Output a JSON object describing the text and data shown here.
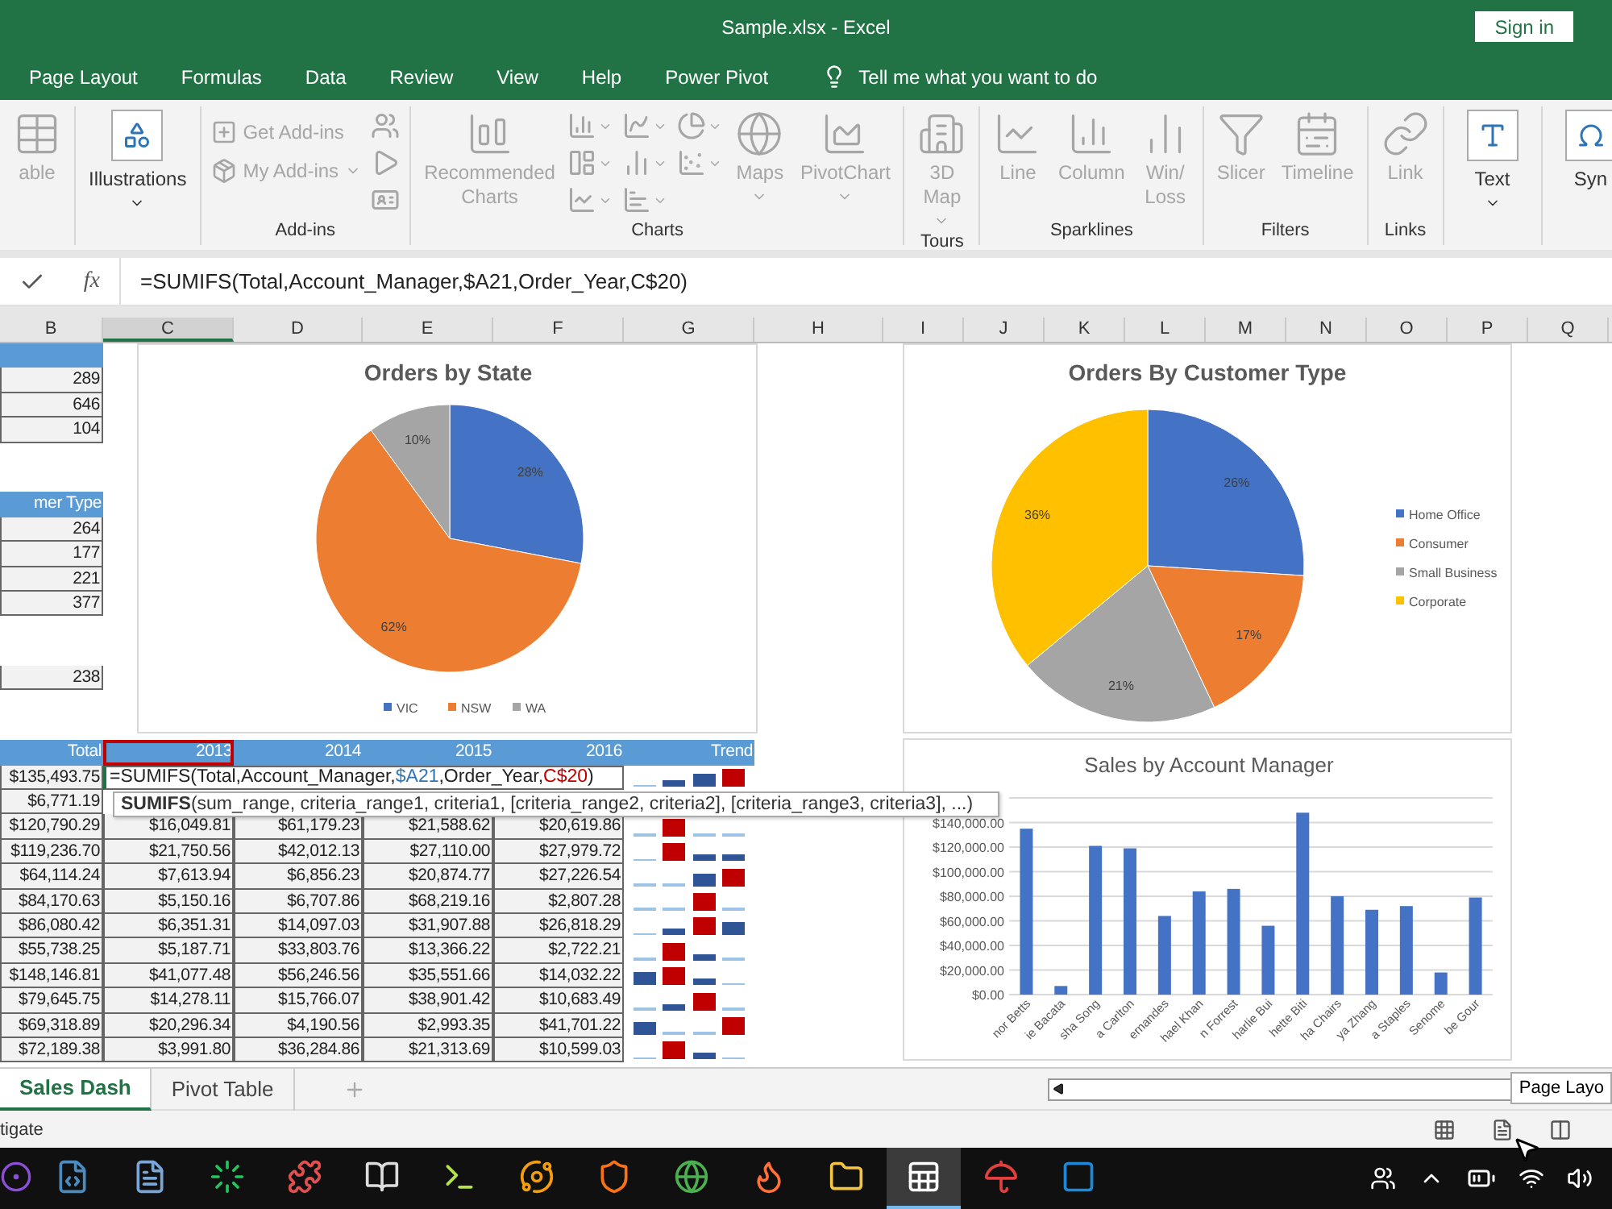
{
  "window": {
    "title": "Sample.xlsx - Excel",
    "sign_in": "Sign in"
  },
  "ribbon_tabs": [
    {
      "label": "Page Layout",
      "selected": false
    },
    {
      "label": "Formulas",
      "selected": false
    },
    {
      "label": "Data",
      "selected": false
    },
    {
      "label": "Review",
      "selected": false
    },
    {
      "label": "View",
      "selected": false
    },
    {
      "label": "Help",
      "selected": false
    },
    {
      "label": "Power Pivot",
      "selected": false
    }
  ],
  "tell_me": "Tell me what you want to do",
  "ribbon_groups": [
    {
      "items": [
        {
          "kind": "large",
          "label": "able",
          "disabled": true,
          "dropdown": false
        }
      ]
    },
    {
      "items": [
        {
          "kind": "collapsed",
          "label": "Illustrations",
          "disabled": false,
          "dropdown": true
        }
      ]
    },
    {
      "label": "Add-ins",
      "items": [
        {
          "kind": "small",
          "label": "Get Add-ins",
          "disabled": true,
          "dropdown": false
        },
        {
          "kind": "small",
          "label": "My Add-ins",
          "disabled": true,
          "dropdown": true
        },
        {
          "kind": "icon",
          "disabled": true,
          "dropdown": false
        },
        {
          "kind": "icon",
          "disabled": true,
          "dropdown": false
        },
        {
          "kind": "icon",
          "disabled": true,
          "dropdown": false
        }
      ]
    },
    {
      "label": "Charts",
      "items": [
        {
          "kind": "large",
          "label": "Recommended\nCharts",
          "disabled": true,
          "dropdown": false
        },
        {
          "kind": "icon",
          "disabled": true,
          "dropdown": true
        },
        {
          "kind": "icon",
          "disabled": true,
          "dropdown": true
        },
        {
          "kind": "icon",
          "disabled": true,
          "dropdown": true
        },
        {
          "kind": "icon",
          "disabled": true,
          "dropdown": true
        },
        {
          "kind": "icon",
          "disabled": true,
          "dropdown": true
        },
        {
          "kind": "icon",
          "disabled": true,
          "dropdown": true
        },
        {
          "kind": "icon",
          "disabled": true,
          "dropdown": true
        },
        {
          "kind": "icon",
          "disabled": true,
          "dropdown": true
        },
        {
          "kind": "large",
          "label": "Maps",
          "disabled": true,
          "dropdown": true
        },
        {
          "kind": "large",
          "label": "PivotChart",
          "disabled": true,
          "dropdown": true
        }
      ]
    },
    {
      "label": "Tours",
      "items": [
        {
          "kind": "large",
          "label": "3D\nMap",
          "disabled": true,
          "dropdown": true
        }
      ]
    },
    {
      "label": "Sparklines",
      "items": [
        {
          "kind": "large",
          "label": "Line",
          "disabled": true,
          "dropdown": false
        },
        {
          "kind": "large",
          "label": "Column",
          "disabled": true,
          "dropdown": false
        },
        {
          "kind": "large",
          "label": "Win/\nLoss",
          "disabled": true,
          "dropdown": false
        }
      ]
    },
    {
      "label": "Filters",
      "items": [
        {
          "kind": "large",
          "label": "Slicer",
          "disabled": true,
          "dropdown": false
        },
        {
          "kind": "large",
          "label": "Timeline",
          "disabled": true,
          "dropdown": false
        }
      ]
    },
    {
      "label": "Links",
      "items": [
        {
          "kind": "large",
          "label": "Link",
          "disabled": true,
          "dropdown": false
        }
      ]
    },
    {
      "items": [
        {
          "kind": "collapsed",
          "label": "Text",
          "disabled": false,
          "dropdown": true
        }
      ]
    },
    {
      "items": [
        {
          "kind": "collapsed",
          "label": "Syn",
          "disabled": false,
          "dropdown": false
        }
      ]
    }
  ],
  "formula_bar": {
    "function_label": "fx",
    "formula": "=SUMIFS(Total,Account_Manager,$A21,Order_Year,C$20)"
  },
  "columns": [
    {
      "label": "B",
      "selected": false
    },
    {
      "label": "C",
      "selected": true
    },
    {
      "label": "D",
      "selected": false
    },
    {
      "label": "E",
      "selected": false
    },
    {
      "label": "F",
      "selected": false
    },
    {
      "label": "G",
      "selected": false
    },
    {
      "label": "H",
      "selected": false
    },
    {
      "label": "I",
      "selected": false
    },
    {
      "label": "J",
      "selected": false
    },
    {
      "label": "K",
      "selected": false
    },
    {
      "label": "L",
      "selected": false
    },
    {
      "label": "M",
      "selected": false
    },
    {
      "label": "N",
      "selected": false
    },
    {
      "label": "O",
      "selected": false
    },
    {
      "label": "P",
      "selected": false
    },
    {
      "label": "Q",
      "selected": false
    }
  ],
  "column_b": [
    {
      "kind": "header"
    },
    {
      "kind": "value",
      "text": "289"
    },
    {
      "kind": "value",
      "text": "646"
    },
    {
      "kind": "value",
      "text": "104"
    },
    {
      "kind": "blank"
    },
    {
      "kind": "blank"
    },
    {
      "kind": "header",
      "text": "mer Type"
    },
    {
      "kind": "value",
      "text": "264"
    },
    {
      "kind": "value",
      "text": "177"
    },
    {
      "kind": "value",
      "text": "221"
    },
    {
      "kind": "value",
      "text": "377"
    },
    {
      "kind": "blank"
    },
    {
      "kind": "blank"
    },
    {
      "kind": "value",
      "text": "238"
    }
  ],
  "pie_charts": [
    {
      "chart_data": {
        "type": "pie",
        "title": "Orders by State",
        "legend": "bottom",
        "categories": [
          "VIC",
          "NSW",
          "WA"
        ],
        "values": [
          28,
          62,
          10
        ],
        "colors": [
          "#4472c4",
          "#ed7d31",
          "#a5a5a5"
        ],
        "value_labels": [
          "28%",
          "62%",
          "10%"
        ]
      }
    },
    {
      "chart_data": {
        "type": "pie",
        "title": "Orders By Customer Type",
        "legend": "right",
        "categories": [
          "Home Office",
          "Consumer",
          "Small Business",
          "Corporate"
        ],
        "values": [
          26,
          17,
          21,
          36
        ],
        "colors": [
          "#4472c4",
          "#ed7d31",
          "#a5a5a5",
          "#ffc000"
        ],
        "value_labels": [
          "26%",
          "17%",
          "21%",
          "36%"
        ]
      }
    }
  ],
  "sales_table": {
    "columns": [
      {
        "label": "Total",
        "selected": false
      },
      {
        "label": "2013",
        "selected": true
      },
      {
        "label": "2014",
        "selected": false
      },
      {
        "label": "2015",
        "selected": false
      },
      {
        "label": "2016",
        "selected": false
      },
      {
        "label": "Trend",
        "selected": false
      }
    ],
    "rows": [
      {
        "cells": [
          "$135,493.75"
        ],
        "editing": [
          {
            "text": "=SUMIFS(Total,Account_Manager,"
          },
          {
            "text": "$A21",
            "color": "#2f75b5"
          },
          {
            "text": ",Order_Year,"
          },
          {
            "text": "C$20",
            "color": "#c00000"
          },
          {
            "text": ")"
          }
        ],
        "trend": [
          {
            "kind": "line"
          },
          {
            "kind": "small"
          },
          {
            "kind": "mid"
          },
          {
            "kind": "peak"
          }
        ]
      },
      {
        "cells": [
          "$6,771.19"
        ]
      },
      {
        "cells": [
          "$120,790.29",
          "$16,049.81",
          "$61,179.23",
          "$21,588.62",
          "$20,619.86"
        ],
        "trend": [
          {
            "kind": "line"
          },
          {
            "kind": "peak"
          },
          {
            "kind": "line"
          },
          {
            "kind": "line"
          }
        ]
      },
      {
        "cells": [
          "$119,236.70",
          "$21,750.56",
          "$42,012.13",
          "$27,110.00",
          "$27,979.72"
        ],
        "trend": [
          {
            "kind": "line"
          },
          {
            "kind": "peak"
          },
          {
            "kind": "small"
          },
          {
            "kind": "small"
          }
        ]
      },
      {
        "cells": [
          "$64,114.24",
          "$7,613.94",
          "$6,856.23",
          "$20,874.77",
          "$27,226.54"
        ],
        "trend": [
          {
            "kind": "line"
          },
          {
            "kind": "line"
          },
          {
            "kind": "mid"
          },
          {
            "kind": "peak"
          }
        ]
      },
      {
        "cells": [
          "$84,170.63",
          "$5,150.16",
          "$6,707.86",
          "$68,219.16",
          "$2,807.28"
        ],
        "trend": [
          {
            "kind": "line"
          },
          {
            "kind": "line"
          },
          {
            "kind": "peak"
          },
          {
            "kind": "line"
          }
        ]
      },
      {
        "cells": [
          "$86,080.42",
          "$6,351.31",
          "$14,097.03",
          "$31,907.88",
          "$26,818.29"
        ],
        "trend": [
          {
            "kind": "line"
          },
          {
            "kind": "small"
          },
          {
            "kind": "peak"
          },
          {
            "kind": "mid"
          }
        ]
      },
      {
        "cells": [
          "$55,738.25",
          "$5,187.71",
          "$33,803.76",
          "$13,366.22",
          "$2,722.21"
        ],
        "trend": [
          {
            "kind": "line"
          },
          {
            "kind": "peak"
          },
          {
            "kind": "small"
          },
          {
            "kind": "line"
          }
        ]
      },
      {
        "cells": [
          "$148,146.81",
          "$41,077.48",
          "$56,246.56",
          "$35,551.66",
          "$14,032.22"
        ],
        "trend": [
          {
            "kind": "mid"
          },
          {
            "kind": "peak"
          },
          {
            "kind": "small"
          },
          {
            "kind": "line"
          }
        ]
      },
      {
        "cells": [
          "$79,645.75",
          "$14,278.11",
          "$15,766.07",
          "$38,901.42",
          "$10,683.49"
        ],
        "trend": [
          {
            "kind": "line"
          },
          {
            "kind": "small"
          },
          {
            "kind": "peak"
          },
          {
            "kind": "line"
          }
        ]
      },
      {
        "cells": [
          "$69,318.89",
          "$20,296.34",
          "$4,190.56",
          "$2,993.35",
          "$41,701.22"
        ],
        "trend": [
          {
            "kind": "mid"
          },
          {
            "kind": "line"
          },
          {
            "kind": "line"
          },
          {
            "kind": "peak"
          }
        ]
      },
      {
        "cells": [
          "$72,189.38",
          "$3,991.80",
          "$36,284.86",
          "$21,313.69",
          "$10,599.03"
        ],
        "trend": [
          {
            "kind": "line"
          },
          {
            "kind": "peak"
          },
          {
            "kind": "small"
          },
          {
            "kind": "line"
          }
        ]
      }
    ]
  },
  "function_tooltip": "**SUMIFS**(sum_range, criteria_range1, criteria1, [criteria_range2, criteria2], [criteria_range3, criteria3], ...)",
  "bar_chart": {
    "chart_data": {
      "type": "bar",
      "title": "Sales by Account Manager",
      "grid": true,
      "categories": [
        "nor Betts",
        "ie Bacata",
        "sha Song",
        "a Carlton",
        "ernandes",
        "hael Khan",
        "n Forrest",
        "harlie Bui",
        "hette Biti",
        "ha Chairs",
        "ya Zhang",
        "a Staples",
        "Senome",
        "be Gour"
      ],
      "series": [
        {
          "color": "#4472c4",
          "values": [
            135000,
            7000,
            121000,
            119000,
            64000,
            84000,
            86000,
            56000,
            148000,
            80000,
            69000,
            72000,
            18000,
            79000
          ]
        }
      ],
      "ylim": [
        0,
        160000
      ],
      "yticks": [
        {
          "value": 0,
          "label": "$0.00"
        },
        {
          "value": 20000,
          "label": "$20,000.00"
        },
        {
          "value": 40000,
          "label": "$40,000.00"
        },
        {
          "value": 60000,
          "label": "$60,000.00"
        },
        {
          "value": 80000,
          "label": "$80,000.00"
        },
        {
          "value": 100000,
          "label": "$100,000.00"
        },
        {
          "value": 120000,
          "label": "$120,000.00"
        },
        {
          "value": 140000,
          "label": "$140,000.00"
        }
      ]
    }
  },
  "sheet_tabs": [
    {
      "label": "Sales Dash",
      "selected": true
    },
    {
      "label": "Pivot Table",
      "selected": false
    }
  ],
  "status_bar": {
    "text": "tigate",
    "tooltip": "Page Layo"
  },
  "taskbar_apps": [
    {
      "selected": false
    },
    {
      "selected": false
    },
    {
      "selected": false
    },
    {
      "selected": false
    },
    {
      "selected": false
    },
    {
      "selected": false
    },
    {
      "selected": false
    },
    {
      "selected": false
    },
    {
      "selected": false
    },
    {
      "selected": false
    },
    {
      "selected": false
    },
    {
      "selected": false
    },
    {
      "selected": true
    },
    {
      "selected": false
    },
    {
      "selected": false
    }
  ]
}
